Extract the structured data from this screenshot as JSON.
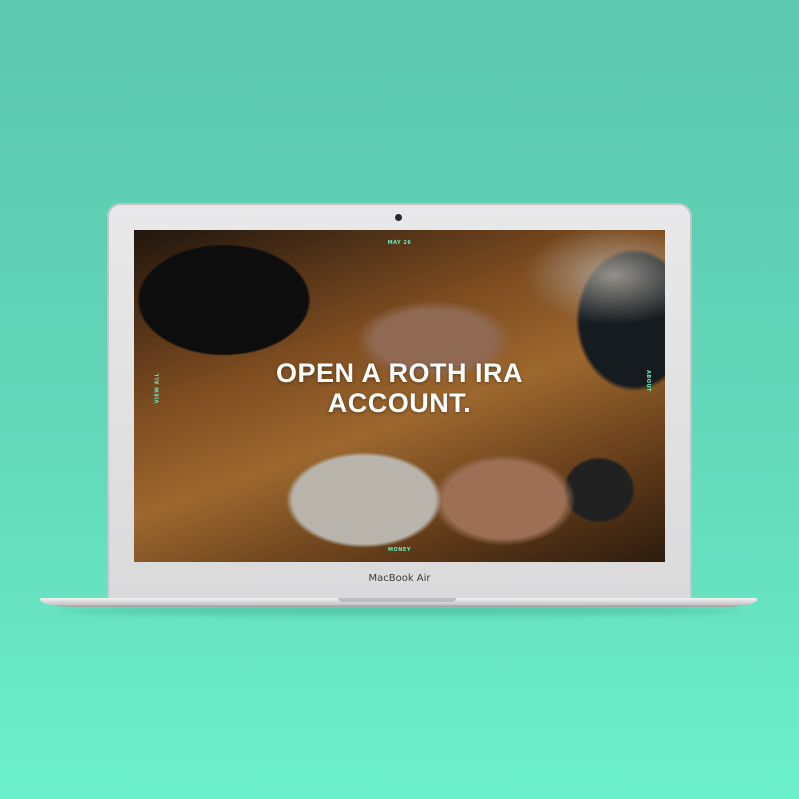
{
  "device": {
    "brand_label": "MacBook Air"
  },
  "site": {
    "date": "MAY 26",
    "left_nav": "VIEW ALL",
    "right_nav": "ABOUT",
    "category": "MONEY",
    "headline_line1": "OPEN A ROTH IRA",
    "headline_line2": "ACCOUNT."
  },
  "colors": {
    "accent": "#5ef0c4",
    "background": "#62d6b8"
  }
}
